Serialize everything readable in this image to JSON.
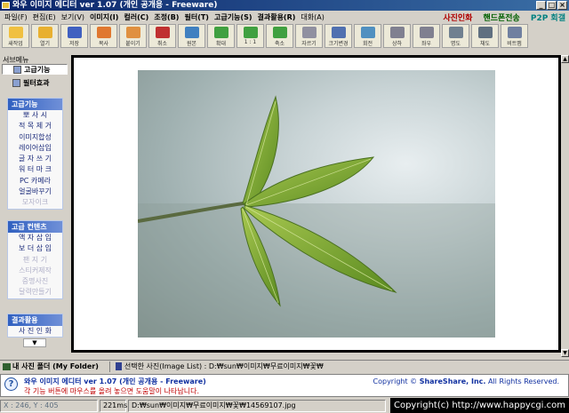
{
  "window": {
    "title": "와우 이미지 에디터 ver 1.07 (개인 공개용 - Freeware)",
    "buttons": [
      "_",
      "□",
      "×"
    ]
  },
  "menu": {
    "items": [
      "파일(F)",
      "편집(E)",
      "보기(V)",
      "이미지(I)",
      "컬러(C)",
      "조정(B)",
      "필터(T)",
      "고급기능(S)",
      "결과활용(R)",
      "대화(A)"
    ],
    "right": [
      "사진인화",
      "핸드폰전송",
      "P2P 회갤"
    ]
  },
  "toolbar": [
    {
      "label": "새작업",
      "color": "#f0c040"
    },
    {
      "label": "열기",
      "color": "#e8b030"
    },
    {
      "label": "저장",
      "color": "#4060c0"
    },
    {
      "label": "복사",
      "color": "#e07830"
    },
    {
      "label": "붙이기",
      "color": "#e09040"
    },
    {
      "label": "취소",
      "color": "#c03030"
    },
    {
      "label": "원본",
      "color": "#4080c0"
    },
    {
      "label": "확대",
      "color": "#40a040"
    },
    {
      "label": "1 : 1",
      "color": "#40a040"
    },
    {
      "label": "축소",
      "color": "#40a040"
    },
    {
      "label": "자르기",
      "color": "#9090a0"
    },
    {
      "label": "크기변경",
      "color": "#5070b0"
    },
    {
      "label": "회전",
      "color": "#5090c0"
    },
    {
      "label": "상하",
      "color": "#808090"
    },
    {
      "label": "좌우",
      "color": "#808090"
    },
    {
      "label": "명도",
      "color": "#708090"
    },
    {
      "label": "채도",
      "color": "#607080"
    },
    {
      "label": "비트맵",
      "color": "#7080a0"
    }
  ],
  "sidebar": {
    "title": "서브메뉴",
    "tabs": [
      "고급기능",
      "필터효과"
    ],
    "groups": [
      {
        "header": "고급기능",
        "items": [
          "뽀 사 시",
          "적 목 제 거",
          "이미지합성",
          "레이어삽입",
          "글 자 쓰 기",
          "워 터 마 크",
          "PC 카메라",
          "얼굴바꾸기",
          "모자이크"
        ],
        "dim": [
          8
        ]
      },
      {
        "header": "고급 컨텐츠",
        "items": [
          "액 자 삽 입",
          "보 더 삽 입",
          "팬 지 기",
          "스티커제작",
          "증명사진",
          "달력만들기"
        ],
        "dim": [
          2,
          3,
          4,
          5
        ]
      },
      {
        "header": "결과활용",
        "items": [
          "사 진 인 화"
        ],
        "dim": []
      }
    ],
    "scroll_down": "▼"
  },
  "folder_bar": {
    "my_folder": "내 사진 폴더 (My Folder)",
    "image_list": "선택한 사진(Image List) : D:₩sun₩이미지₩무료이미지₩꽃₩"
  },
  "help": {
    "title": "와우 이미지 에디터 ver 1.07 (개인 공개용 - Freeware)",
    "hint": "각 기능 버튼에 마우스를 올려 놓으면 도움말이 나타납니다.",
    "copyright_prefix": "Copyright ©",
    "copyright_company": "ShareShare, Inc.",
    "copyright_suffix": "All Rights Reserved."
  },
  "status": {
    "coords": "X : 246, Y : 405",
    "time": "221ms",
    "path": "D:₩sun₩이미지₩무료이미지₩꽃₩14569107.jpg",
    "banner": "Copyright(c) http://www.happycgi.com"
  }
}
